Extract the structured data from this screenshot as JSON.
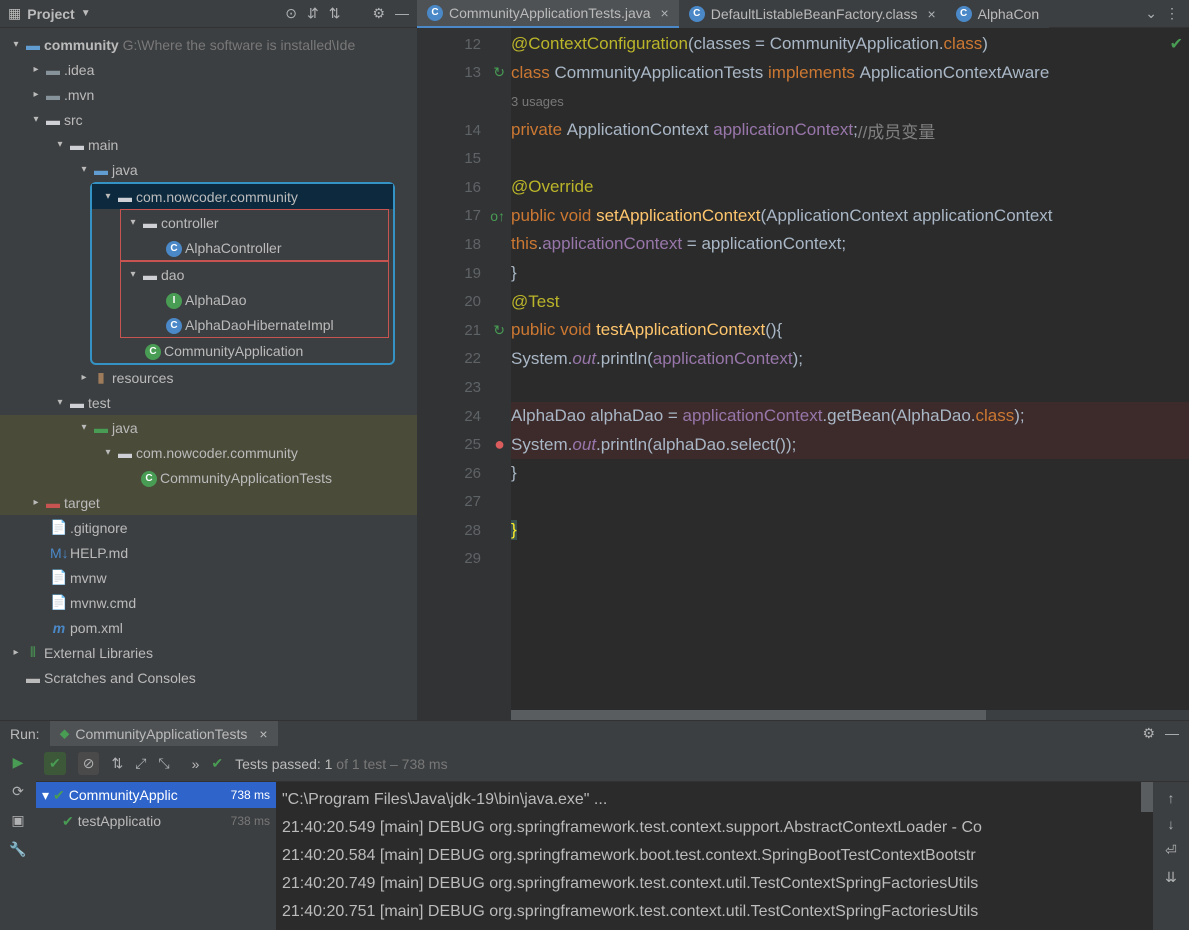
{
  "sidebar": {
    "title": "Project",
    "root": {
      "name": "community",
      "path": "G:\\Where the software is installed\\Ide"
    },
    "items": {
      "idea": ".idea",
      "mvn": ".mvn",
      "src": "src",
      "main": "main",
      "java": "java",
      "pkg": "com.nowcoder.community",
      "controller": "controller",
      "alphaController": "AlphaController",
      "dao": "dao",
      "alphaDao": "AlphaDao",
      "alphaDaoHib": "AlphaDaoHibernateImpl",
      "commApp": "CommunityApplication",
      "resources": "resources",
      "test": "test",
      "java2": "java",
      "pkg2": "com.nowcoder.community",
      "commAppTests": "CommunityApplicationTests",
      "target": "target",
      "gitignore": ".gitignore",
      "help": "HELP.md",
      "mvnw": "mvnw",
      "mvnwcmd": "mvnw.cmd",
      "pom": "pom.xml",
      "extlib": "External Libraries",
      "scratch": "Scratches and Consoles"
    }
  },
  "tabs": {
    "t1": "CommunityApplicationTests.java",
    "t2": "DefaultListableBeanFactory.class",
    "t3": "AlphaCon"
  },
  "gutter": [
    "12",
    "13",
    "",
    "14",
    "15",
    "16",
    "17",
    "18",
    "19",
    "20",
    "21",
    "22",
    "23",
    "24",
    "25",
    "26",
    "27",
    "28",
    "29"
  ],
  "code": {
    "l12a": "@ContextConfiguration",
    "l12b": "(classes = CommunityApplication.",
    "l12c": "class",
    "l12d": ")",
    "l13a": "class ",
    "l13b": "CommunityApplicationTests ",
    "l13c": "implements ",
    "l13d": "ApplicationContextAware",
    "usages": "3 usages",
    "l14a": "private ",
    "l14b": "ApplicationContext ",
    "l14c": "applicationContext",
    "l14d": ";",
    "l14e": "//成员变量",
    "l16": "@Override",
    "l17a": "public ",
    "l17b": "void ",
    "l17c": "setApplicationContext",
    "l17d": "(ApplicationContext applicationContext",
    "l18a": "this",
    "l18b": ".",
    "l18c": "applicationContext",
    "l18d": " = applicationContext;",
    "l19": "}",
    "l20": "@Test",
    "l21a": "public ",
    "l21b": "void ",
    "l21c": "testApplicationContext",
    "l21d": "(){",
    "l22a": "System.",
    "l22b": "out",
    "l22c": ".println(",
    "l22d": "applicationContext",
    "l22e": ");",
    "l24a": "AlphaDao alphaDao = ",
    "l24b": "applicationContext",
    "l24c": ".getBean(AlphaDao.",
    "l24d": "class",
    "l24e": ");",
    "l25a": "System.",
    "l25b": "out",
    "l25c": ".println(alphaDao.select());",
    "l26": "}",
    "l28": "}"
  },
  "run": {
    "label": "Run:",
    "tab": "CommunityApplicationTests",
    "status": "Tests passed: 1",
    "statusOf": " of 1 test – 738 ms",
    "tree": {
      "root": "CommunityApplic",
      "rootTime": "738 ms",
      "test": "testApplicatio",
      "testTime": "738 ms"
    },
    "console": [
      "\"C:\\Program Files\\Java\\jdk-19\\bin\\java.exe\" ...",
      "21:40:20.549 [main] DEBUG org.springframework.test.context.support.AbstractContextLoader - Co",
      "21:40:20.584 [main] DEBUG org.springframework.boot.test.context.SpringBootTestContextBootstr",
      "21:40:20.749 [main] DEBUG org.springframework.test.context.util.TestContextSpringFactoriesUtils",
      "21:40:20.751 [main] DEBUG org.springframework.test.context.util.TestContextSpringFactoriesUtils"
    ]
  }
}
